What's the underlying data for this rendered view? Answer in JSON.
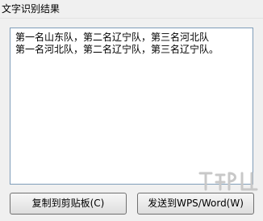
{
  "window": {
    "title": "文字识别结果"
  },
  "result": {
    "lines": [
      "第一名山东队，第二名辽宁队，第三名河北队",
      "第一名河北队，第二名辽宁队，第三名辽宁队。"
    ]
  },
  "buttons": {
    "copy_label": "复制到剪贴板(C)",
    "send_label": "发送到WPS/Word(W)"
  },
  "watermark": {
    "icon": "watermark-logo-icon"
  }
}
